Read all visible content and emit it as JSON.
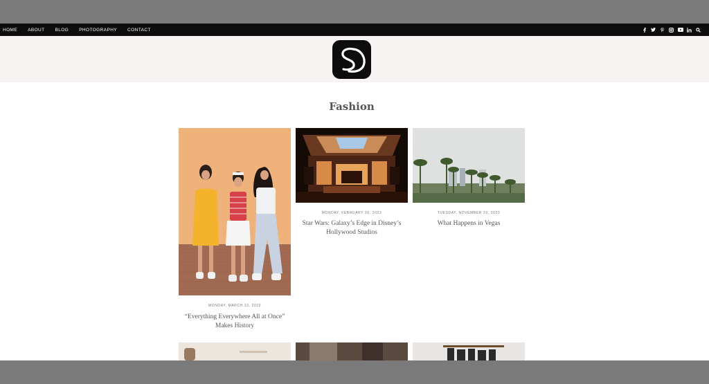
{
  "nav": {
    "links": [
      "HOME",
      "ABOUT",
      "BLOG",
      "PHOTOGRAPHY",
      "CONTACT"
    ],
    "social": [
      "facebook-icon",
      "twitter-icon",
      "pinterest-icon",
      "instagram-icon",
      "youtube-icon",
      "linkedin-icon",
      "search-icon"
    ],
    "social_glyphs": [
      "f",
      "t",
      "p",
      "◎",
      "▶",
      "in",
      "⌕"
    ]
  },
  "header": {
    "logo_icon": "sd-monogram-logo"
  },
  "page": {
    "title": "Fashion"
  },
  "posts": [
    {
      "date": "MONDAY, MARCH 13, 2023",
      "title_lines": [
        "“Everything Everywhere All at Once”",
        "Makes History"
      ]
    },
    {
      "date": "MONDAY, FEBRUARY 20, 2023",
      "title_lines": [
        "Star Wars: Galaxy’s Edge in Disney’s",
        "Hollywood Studios"
      ]
    },
    {
      "date": "TUESDAY, NOVEMBER 29, 2022",
      "title_lines": [
        "What Happens in Vegas"
      ]
    }
  ],
  "colors": {
    "nav_bg": "#0d0d0d",
    "header_bg": "#f7f3f2",
    "frame_gray": "#7a7a7a",
    "text_gray": "#555555"
  }
}
